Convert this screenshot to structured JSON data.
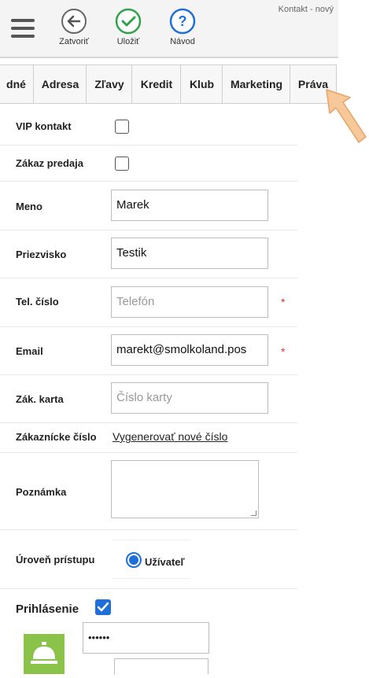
{
  "toolbar": {
    "close_label": "Zatvoriť",
    "save_label": "Uložiť",
    "guide_label": "Návod",
    "title": "Kontakt - nový"
  },
  "tabs": [
    "dné",
    "Adresa",
    "Zľavy",
    "Kredit",
    "Klub",
    "Marketing",
    "Práva"
  ],
  "form": {
    "vip_label": "VIP kontakt",
    "ban_label": "Zákaz predaja",
    "name_label": "Meno",
    "name_value": "Marek",
    "surname_label": "Priezvisko",
    "surname_value": "Testik",
    "phone_label": "Tel. číslo",
    "phone_placeholder": "Telefón",
    "email_label": "Email",
    "email_value": "marekt@smolkoland.pos",
    "card_label": "Zák. karta",
    "card_placeholder": "Číslo karty",
    "custnum_label": "Zákaznícke číslo",
    "custnum_link": "Vygenerovať nové číslo",
    "note_label": "Poznámka",
    "access_label": "Úroveň prístupu",
    "access_option": "Užívateľ",
    "login_label": "Prihlásenie",
    "password_value": "••••••",
    "required_mark": "*"
  },
  "colors": {
    "accent_blue": "#1f6fd8",
    "success_green": "#2ea34a",
    "login_icon_bg": "#8bc34a",
    "arrow": "#f6c89a"
  }
}
